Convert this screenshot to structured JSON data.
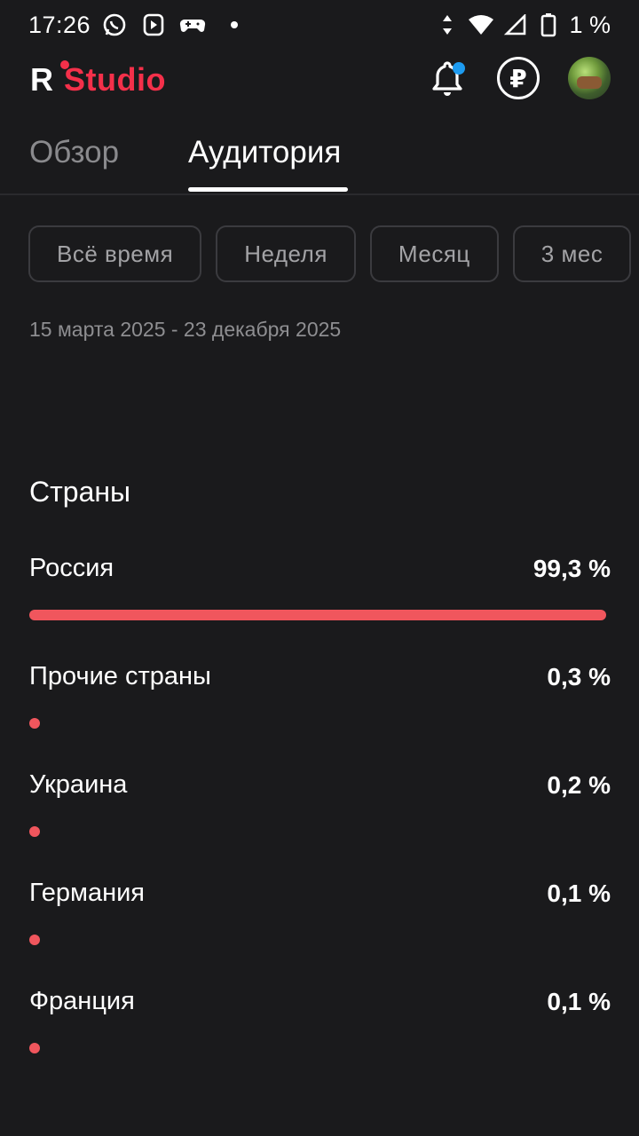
{
  "status_bar": {
    "time": "17:26",
    "battery": "1 %",
    "icons_left": [
      "whatsapp-icon",
      "play-store-icon",
      "gamepad-icon",
      "dot-icon"
    ],
    "icons_right": [
      "data-arrows-icon",
      "wifi-icon",
      "cellular-icon",
      "battery-icon"
    ]
  },
  "app_bar": {
    "logo_r": "R",
    "logo_text": "Studio",
    "brand_color": "#f4304a",
    "badge_color": "#1d9bf0",
    "ruble_symbol": "₽"
  },
  "tabs": [
    {
      "label": "Обзор",
      "active": false
    },
    {
      "label": "Аудитория",
      "active": true
    }
  ],
  "filters": [
    "Всё время",
    "Неделя",
    "Месяц",
    "3 мес"
  ],
  "date_range": "15 марта 2025 - 23 декабря 2025",
  "countries_section": {
    "title": "Страны",
    "bar_color": "#f0565d",
    "items": [
      {
        "name": "Россия",
        "percent_label": "99,3 %",
        "share": 0.993
      },
      {
        "name": "Прочие страны",
        "percent_label": "0,3 %",
        "share": 0.003
      },
      {
        "name": "Украина",
        "percent_label": "0,2 %",
        "share": 0.002
      },
      {
        "name": "Германия",
        "percent_label": "0,1 %",
        "share": 0.001
      },
      {
        "name": "Франция",
        "percent_label": "0,1 %",
        "share": 0.001
      }
    ]
  }
}
